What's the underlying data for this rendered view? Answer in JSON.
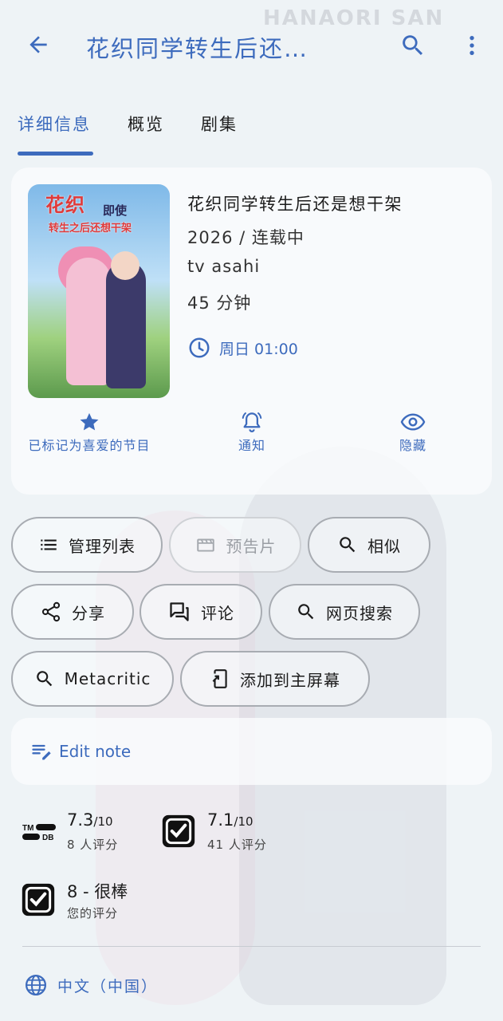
{
  "topbar": {
    "title": "花织同学转生后还…",
    "back_icon": "arrow-back-icon",
    "search_icon": "search-icon",
    "more_icon": "more-vert-icon"
  },
  "tabs": [
    {
      "label": "详细信息",
      "active": true
    },
    {
      "label": "概览",
      "active": false
    },
    {
      "label": "剧集",
      "active": false
    }
  ],
  "poster": {
    "brand": "HANAORI SAN",
    "title_line1": "花织",
    "title_side": "即使",
    "title_line2": "转生之后还想干架"
  },
  "show": {
    "name": "花织同学转生后还是想干架",
    "year_status": "2026 / 连载中",
    "network": "tv asahi",
    "runtime": "45 分钟",
    "airtime": "周日 01:00"
  },
  "actions": {
    "favorite": "已标记为喜爱的节目",
    "notify": "通知",
    "hide": "隐藏"
  },
  "chips": {
    "manage_list": "管理列表",
    "trailer": "预告片",
    "similar": "相似",
    "share": "分享",
    "comments": "评论",
    "web_search": "网页搜索",
    "metacritic": "Metacritic",
    "add_home": "添加到主屏幕"
  },
  "note": {
    "label": "Edit note"
  },
  "ratings": {
    "tmdb": {
      "score": "7.3",
      "out_of": "/10",
      "count": "8 人评分",
      "logo": "TM DB"
    },
    "trakt": {
      "score": "7.1",
      "out_of": "/10",
      "count": "41 人评分"
    },
    "user": {
      "score": "8 - 很棒",
      "label": "您的评分"
    }
  },
  "language": {
    "label": "中文（中国）"
  },
  "colors": {
    "accent": "#3d6bbd",
    "background": "#eef3f6"
  }
}
